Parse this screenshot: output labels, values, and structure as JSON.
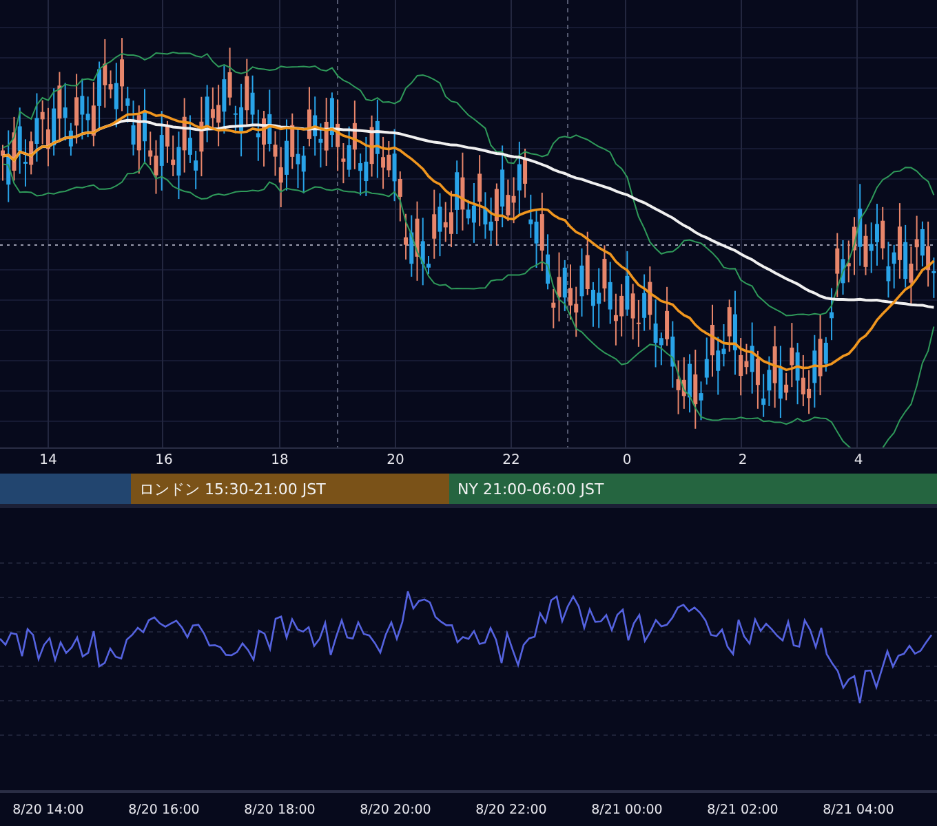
{
  "price_chart": {
    "time_axis": [
      "14",
      "16",
      "18",
      "20",
      "22",
      "0",
      "2",
      "4"
    ]
  },
  "sessions": [
    {
      "color": "#22456f"
    },
    {
      "label": "ロンドン 15:30-21:00 JST",
      "color": "#7a5218"
    },
    {
      "label": "NY 21:00-06:00 JST",
      "color": "#256540"
    }
  ],
  "oscillator": {
    "time_axis": [
      "8/20 14:00",
      "8/20 16:00",
      "8/20 18:00",
      "8/20 20:00",
      "8/20 22:00",
      "8/21 00:00",
      "8/21 02:00",
      "8/21 04:00"
    ]
  }
}
